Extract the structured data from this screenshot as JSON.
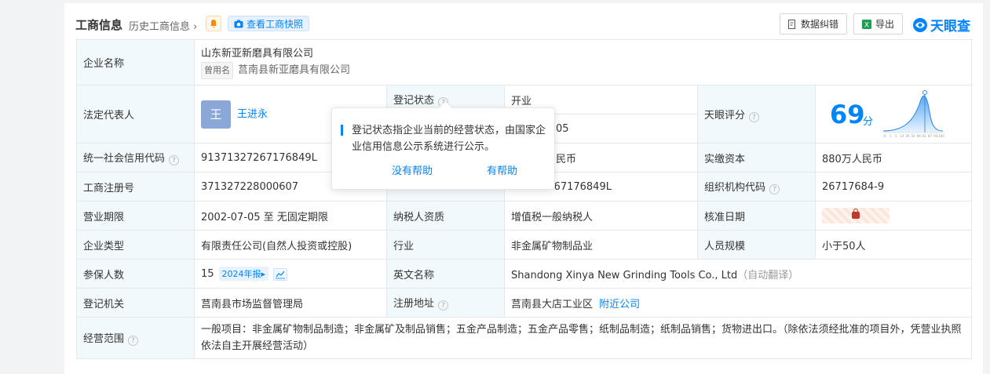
{
  "header": {
    "title": "工商信息",
    "history": "历史工商信息",
    "history_arrow": "›",
    "snapshot_label": "查看工商快照",
    "fix_label": "数据纠错",
    "export_label": "导出",
    "logo_text": "天眼查"
  },
  "company": {
    "name_label": "企业名称",
    "name": "山东新亚新磨具有限公司",
    "former_tag": "曾用名",
    "former_name": "莒南县新亚磨具有限公司",
    "legal_label": "法定代表人",
    "legal_avatar": "王",
    "legal_name": "王进永",
    "reg_status_label": "登记状态",
    "reg_status": "开业",
    "found_value_tail": "05",
    "capital_tail": "民币",
    "tianyan_label": "天眼评分",
    "score": "69",
    "score_unit": "分",
    "credit_label": "统一社会信用代码",
    "credit_code": "91371327267176849L",
    "paid_label": "实缴资本",
    "paid_capital": "880万人民币",
    "regno_label": "工商注册号",
    "regno": "371327228000607",
    "taxid_tail": "7267176849L",
    "org_label": "组织机构代码",
    "org_code": "26717684-9",
    "term_label": "营业期限",
    "term": "2002-07-05 至 无固定期限",
    "taxpayer_label": "纳税人资质",
    "taxpayer": "增值税一般纳税人",
    "approve_label": "核准日期",
    "type_label": "企业类型",
    "type": "有限责任公司(自然人投资或控股)",
    "industry_label": "行业",
    "industry": "非金属矿物制品业",
    "staff_label": "人员规模",
    "staff": "小于50人",
    "insured_label": "参保人数",
    "insured": "15",
    "insured_tag": "2024年报",
    "insured_tag_arrow": "▸",
    "en_label": "英文名称",
    "en_name": "Shandong Xinya New Grinding Tools Co., Ltd",
    "en_note": "（自动翻译）",
    "authority_label": "登记机关",
    "authority": "莒南县市场监督管理局",
    "address_label": "注册地址",
    "address": "莒南县大店工业区",
    "nearby": "附近公司",
    "scope_label": "经营范围",
    "scope": "一般项目：非金属矿物制品制造；非金属矿及制品销售；五金产品制造；五金产品零售；纸制品制造；纸制品销售；货物进出口。（除依法须经批准的项目外，凭营业执照依法自主开展经营活动）"
  },
  "score_chart": {
    "ticks": [
      "0",
      "1",
      "5",
      "13",
      "29",
      "50",
      "69",
      "81",
      "87",
      "93",
      "100"
    ]
  },
  "tooltip": {
    "text": "登记状态指企业当前的经营状态，由国家企业信用信息公示系统进行公示。",
    "no_help": "没有帮助",
    "helpful": "有帮助"
  },
  "colors": {
    "accent": "#0084ff",
    "label_bg": "#f2f9fc",
    "status_green": "#21a33a"
  },
  "icons": [
    "bell-icon",
    "camera-icon",
    "edit-icon",
    "excel-icon",
    "help-icon",
    "trend-icon",
    "lock-icon"
  ]
}
